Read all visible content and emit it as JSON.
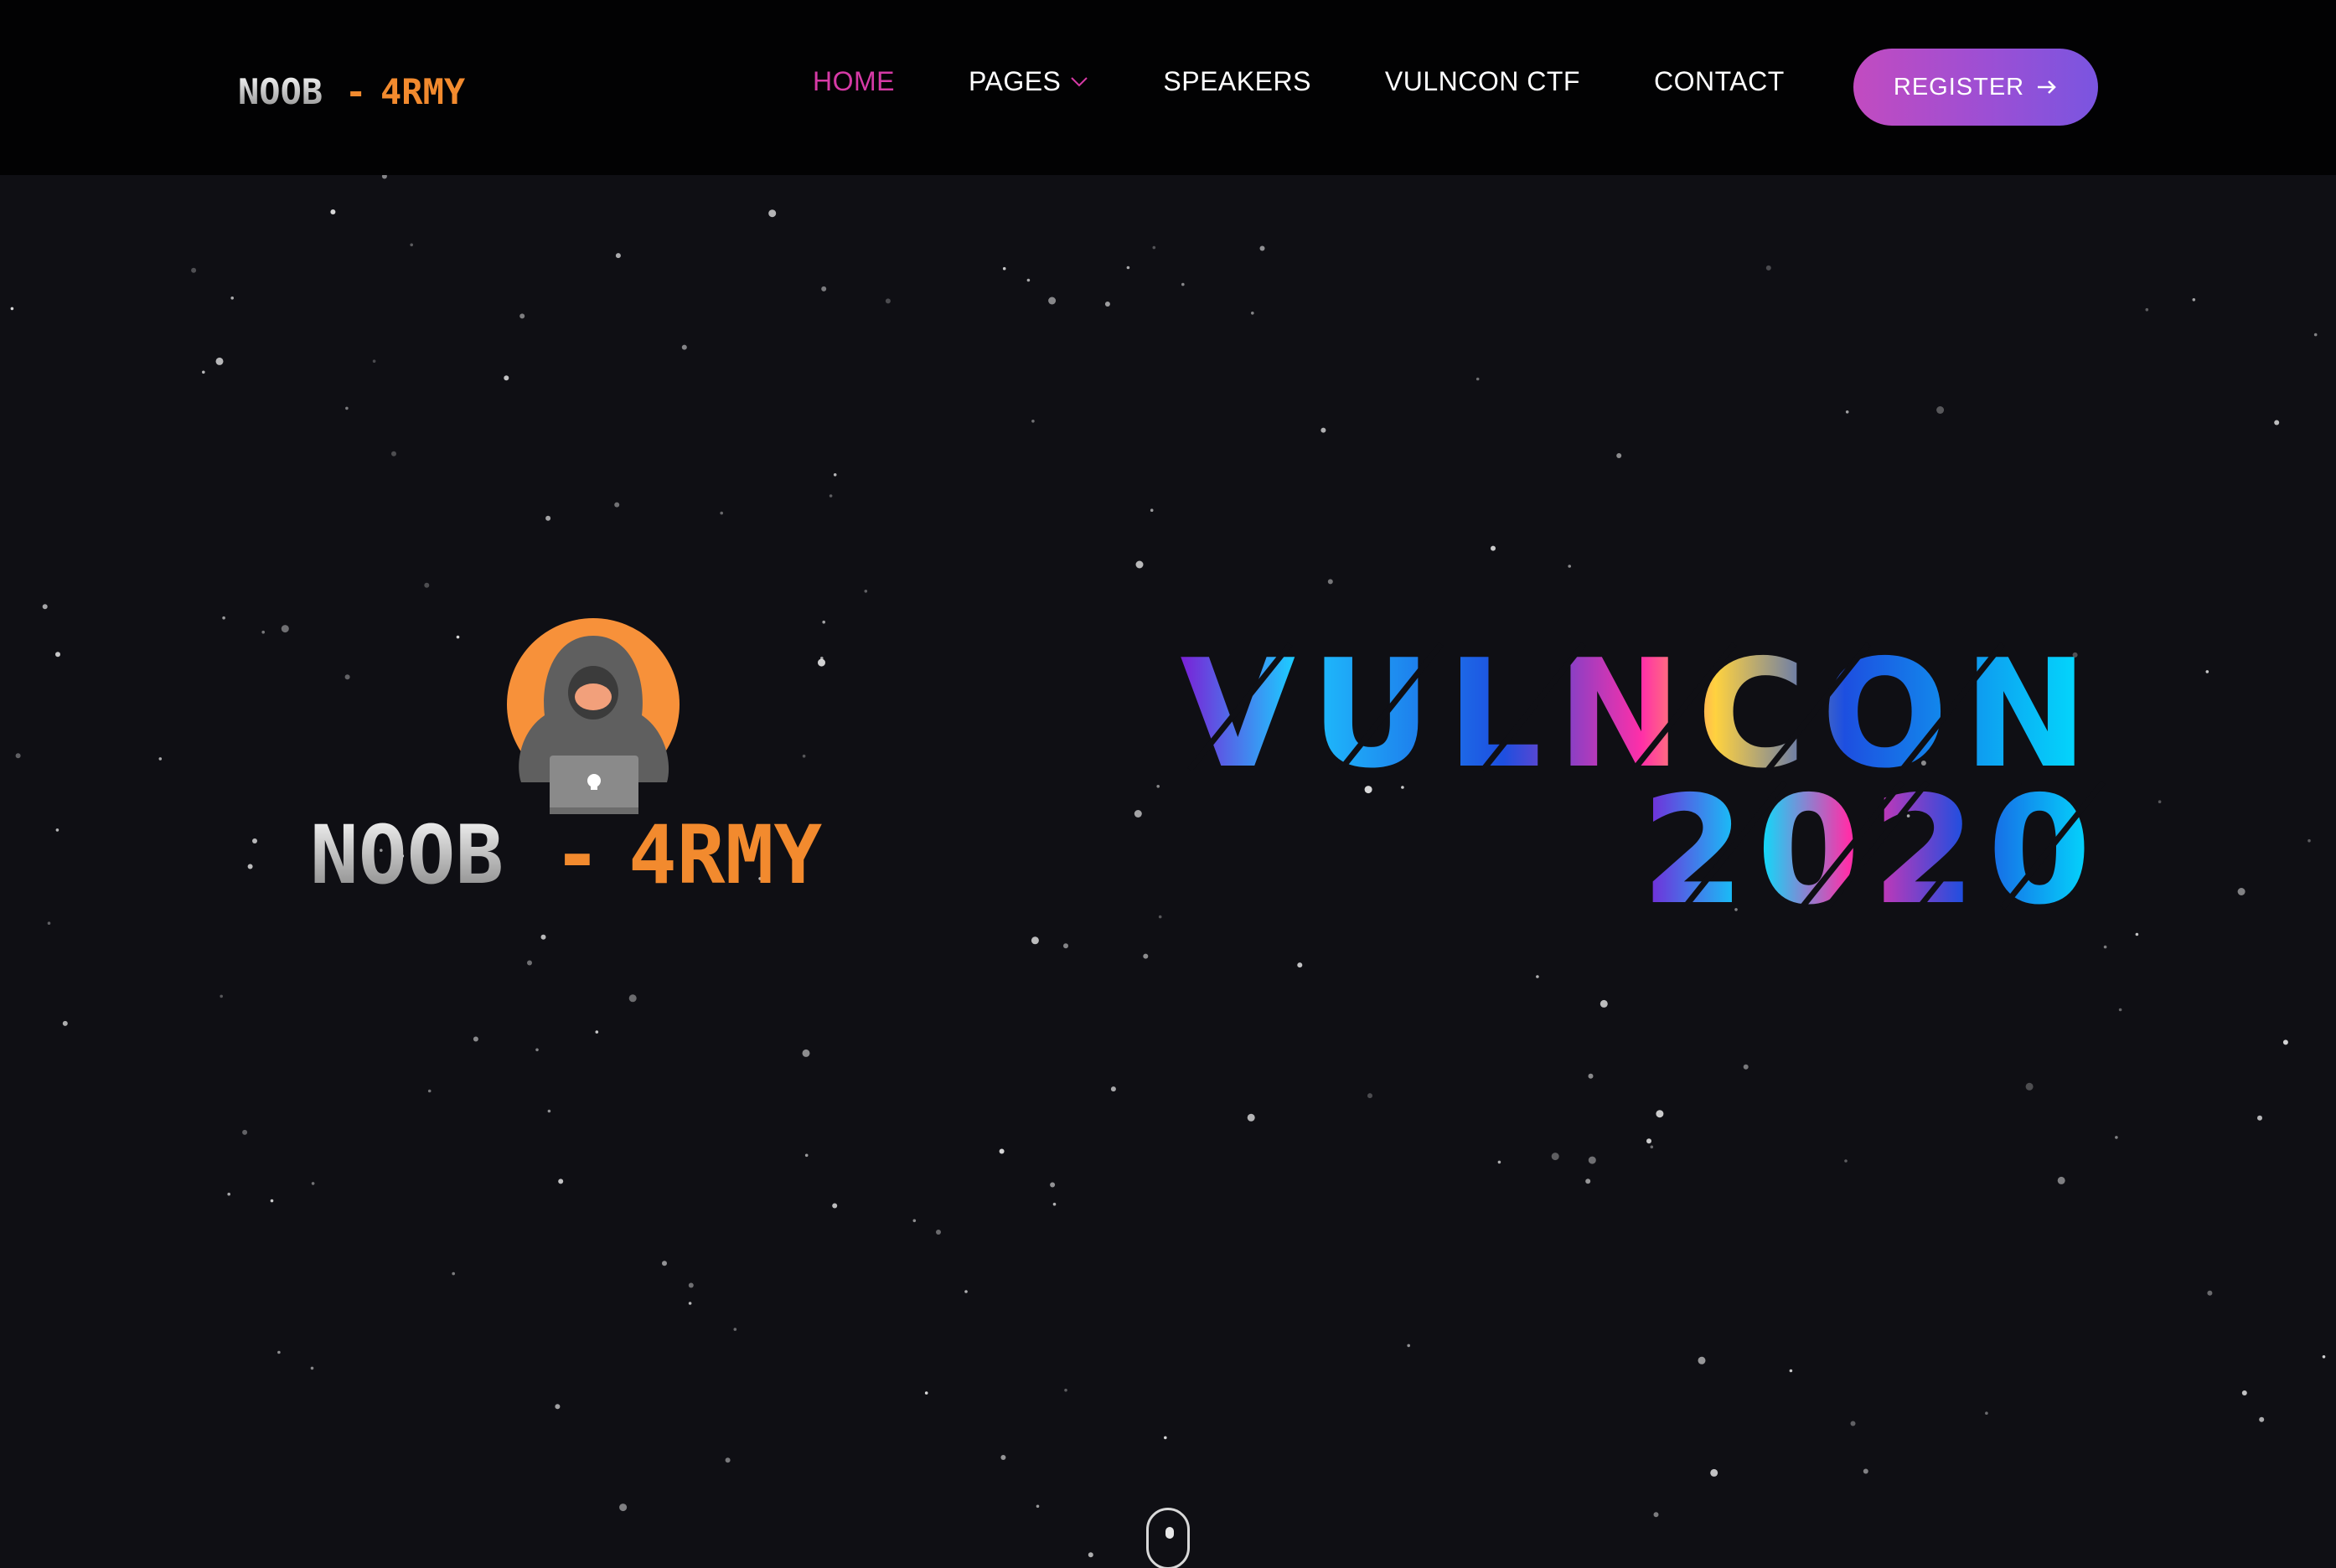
{
  "header": {
    "logo": {
      "left": "NOOB",
      "dash": "-",
      "right": "4RMY"
    },
    "nav": [
      {
        "label": "HOME",
        "active": true
      },
      {
        "label": "PAGES",
        "has_dropdown": true
      },
      {
        "label": "SPEAKERS"
      },
      {
        "label": "VULNCON CTF"
      },
      {
        "label": "CONTACT"
      }
    ],
    "register": {
      "label": "REGISTER",
      "icon": "arrow-right-icon"
    }
  },
  "hero": {
    "logo": {
      "left": "NOOB",
      "dash": "-",
      "right": "4RMY",
      "icon": "hacker-hoodie-icon"
    },
    "title_line1": "VULNCON",
    "title_line2": "2020",
    "scroll_icon": "mouse-scroll-icon"
  },
  "colors": {
    "accent": "#d63aa6",
    "logo_orange": "#f28a2e",
    "background": "#0f0f14",
    "header_bg": "#020203",
    "button_gradient": [
      "#c24bc0",
      "#7a55e0"
    ],
    "title_gradient": [
      "#7b1fd6",
      "#ff2fa8",
      "#ffd23f",
      "#00e5ff"
    ]
  }
}
